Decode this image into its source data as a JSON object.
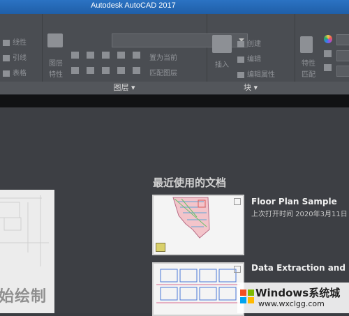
{
  "window": {
    "title": "Autodesk AutoCAD 2017"
  },
  "ribbon": {
    "annot_tools": [
      "线性",
      "引线",
      "表格"
    ],
    "layers_panel": {
      "label": "图层",
      "tool_labels": [
        "置为当前",
        "匹配图层"
      ],
      "vertical_labels": [
        "图层",
        "特性"
      ]
    },
    "block_panel": {
      "label": "块",
      "insert_label": "插入",
      "tools": [
        "创建",
        "编辑",
        "编辑属性"
      ]
    },
    "properties_panel": {
      "tool_labels": [
        "特性",
        "匹配"
      ]
    }
  },
  "main": {
    "recent_heading": "最近使用的文档",
    "recent_items": [
      {
        "title": "Floor Plan Sample",
        "meta": "上次打开时间 2020年3月11日"
      },
      {
        "title": "Data Extraction and Mu"
      }
    ],
    "start_label": "始绘制"
  },
  "watermark": {
    "brand": "Windows系统城",
    "site": "www.wxclgg.com"
  },
  "colors": {
    "background": "#3a3d42",
    "ribbon": "#4a4d52",
    "title_bar": "#2b73c3",
    "accent": "#1f5fa8"
  }
}
